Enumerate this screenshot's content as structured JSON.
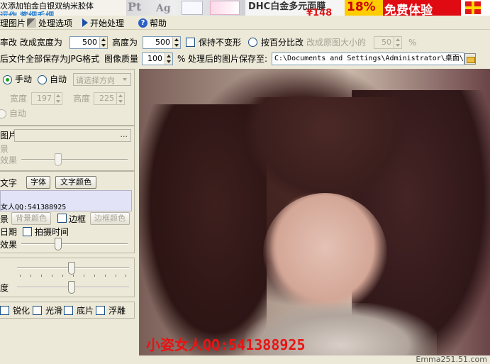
{
  "banner": {
    "ad1_line1": "次添加铂金白银双纳米胶体",
    "ad1_line2": "运作 紫细毛细",
    "ad2_pt": "Pt",
    "ad2_ag": "Ag",
    "ad3_line1": "DHC白金多元面膜",
    "ad3_price": "¥148",
    "ad4_pct": "18%",
    "ad5_text": "免费体验"
  },
  "menu": {
    "item0": "理图片",
    "item1": "处理选项",
    "item2": "开始处理",
    "item3": "帮助"
  },
  "opts": {
    "rate_label": "率改 改成宽度为",
    "width_value": "500",
    "height_label": "高度为",
    "height_value": "500",
    "keep_ratio": "保持不变形",
    "percent_label": "按百分比改",
    "percent_hint": "改成原图大小的",
    "percent_value": "50",
    "percent_unit": "%",
    "jpg_label": "后文件全部保存为JPG格式",
    "quality_label": "图像质量",
    "quality_value": "100",
    "quality_unit": "%",
    "save_label": "处理后的图片保存至:",
    "save_path": "C:\\Documents and Settings\\Administrator\\桌面\\"
  },
  "left": {
    "manual": "手动",
    "auto": "自动",
    "direction_placeholder": "请选择方向",
    "width_label": "宽度",
    "width_val": "197",
    "height_label": "高度",
    "height_val": "225",
    "auto2": "自动",
    "img_label": "图片",
    "file_dots": "...",
    "bg_label": "景",
    "effect_label": "效果",
    "text_label": "文字",
    "font_btn": "字体",
    "color_btn": "文字颜色",
    "text_value": "女人QQ:541388925",
    "bg2_label": "景",
    "bgcolor_btn": "背景颜色",
    "border_label": "边框",
    "bordercolor_btn": "边框颜色",
    "date_label": "日期",
    "shoot_time": "拍摄时间",
    "effect2_label": "效果",
    "degree_label": "度",
    "sharpen": "锐化",
    "smooth": "光滑",
    "negative": "底片",
    "emboss": "浮雕"
  },
  "photo": {
    "watermark": "小姿女人QQ:541388925",
    "site": "Emma251.51.com"
  }
}
